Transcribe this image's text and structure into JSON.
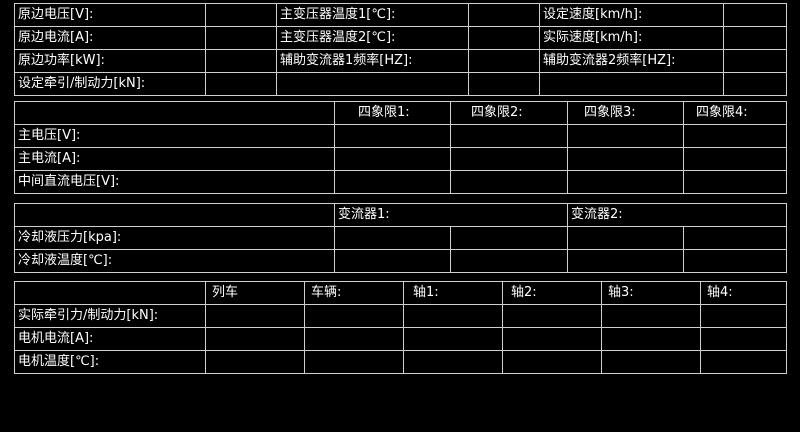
{
  "panel1": {
    "primary_voltage": "原边电压[V]:",
    "primary_current": "原边电流[A]:",
    "primary_power": "原边功率[kW]:",
    "set_traction_force": "设定牵引/制动力[kN]:",
    "main_transformer_temp1": "主变压器温度1[℃]:",
    "main_transformer_temp2": "主变压器温度2[℃]:",
    "aux_converter1_freq": "辅助变流器1频率[HZ]:",
    "set_speed": "设定速度[km/h]:",
    "actual_speed": "实际速度[km/h]:",
    "aux_converter2_freq": "辅助变流器2频率[HZ]:"
  },
  "panel2": {
    "headers": [
      "四象限1:",
      "四象限2:",
      "四象限3:",
      "四象限4:"
    ],
    "rows": [
      "主电压[V]:",
      "主电流[A]:",
      "中间直流电压[V]:"
    ]
  },
  "panel3": {
    "headers": [
      "变流器1:",
      "变流器2:"
    ],
    "rows": [
      "冷却液压力[kpa]:",
      "冷却液温度[℃]:"
    ]
  },
  "panel4": {
    "headers": [
      "列车",
      "车辆:",
      "轴1:",
      "轴2:",
      "轴3:",
      "轴4:"
    ],
    "rows": [
      "实际牵引力/制动力[kN]:",
      "电机电流[A]:",
      "电机温度[℃]:"
    ]
  }
}
